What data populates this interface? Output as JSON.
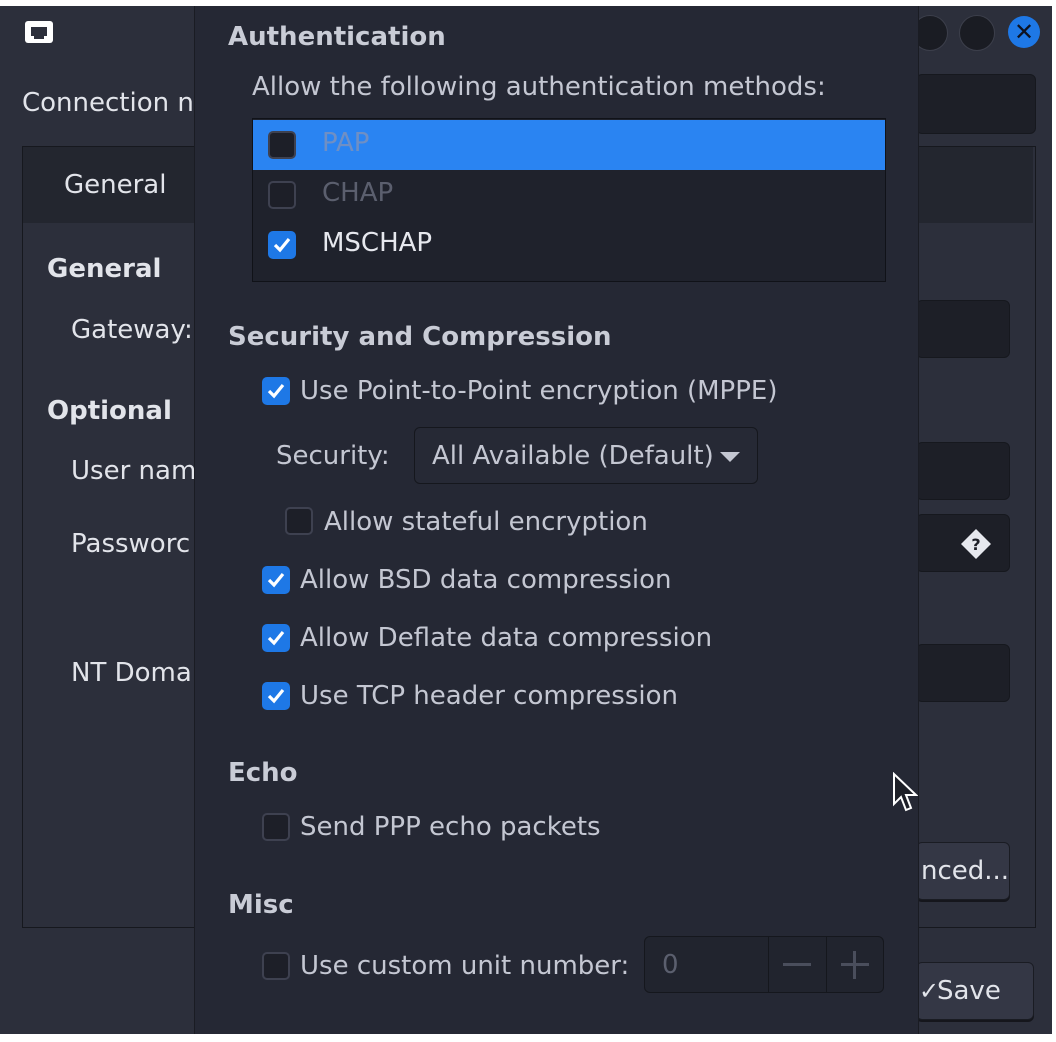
{
  "background_window": {
    "connection_name_label": "Connection na",
    "tab_general": "General",
    "section_general": "General",
    "gateway_label": "Gateway:",
    "section_optional": "Optional",
    "user_name_label": "User nam",
    "password_label": "Passworc",
    "nt_domain_label": "NT Doma",
    "advanced_button": "nced...",
    "save_button": "Save"
  },
  "dialog": {
    "authentication": {
      "title": "Authentication",
      "methods_label": "Allow the following authentication methods:",
      "methods": [
        {
          "label": "PAP",
          "checked": false,
          "selected": true
        },
        {
          "label": "CHAP",
          "checked": false,
          "selected": false
        },
        {
          "label": "MSCHAP",
          "checked": true,
          "selected": false
        }
      ]
    },
    "security": {
      "title": "Security and Compression",
      "use_mppe": "Use Point-to-Point encryption (MPPE)",
      "security_label": "Security:",
      "security_value": "All Available (Default)",
      "stateful": "Allow stateful encryption",
      "bsd": "Allow BSD data compression",
      "deflate": "Allow Deflate data compression",
      "tcp": "Use TCP header compression"
    },
    "echo": {
      "title": "Echo",
      "send_echo": "Send PPP echo packets"
    },
    "misc": {
      "title": "Misc",
      "custom_unit": "Use custom unit number:",
      "unit_value": "0"
    }
  },
  "colors": {
    "accent": "#1e78e6",
    "selection": "#2a84f2",
    "dialog_bg": "#252834",
    "window_bg": "#2c2f3b"
  },
  "icons": [
    "network-icon",
    "minimize-icon",
    "maximize-icon",
    "close-icon",
    "password-options-icon",
    "checkmark-icon",
    "dropdown-arrow-icon",
    "minus-icon",
    "plus-icon",
    "mouse-pointer-icon"
  ]
}
